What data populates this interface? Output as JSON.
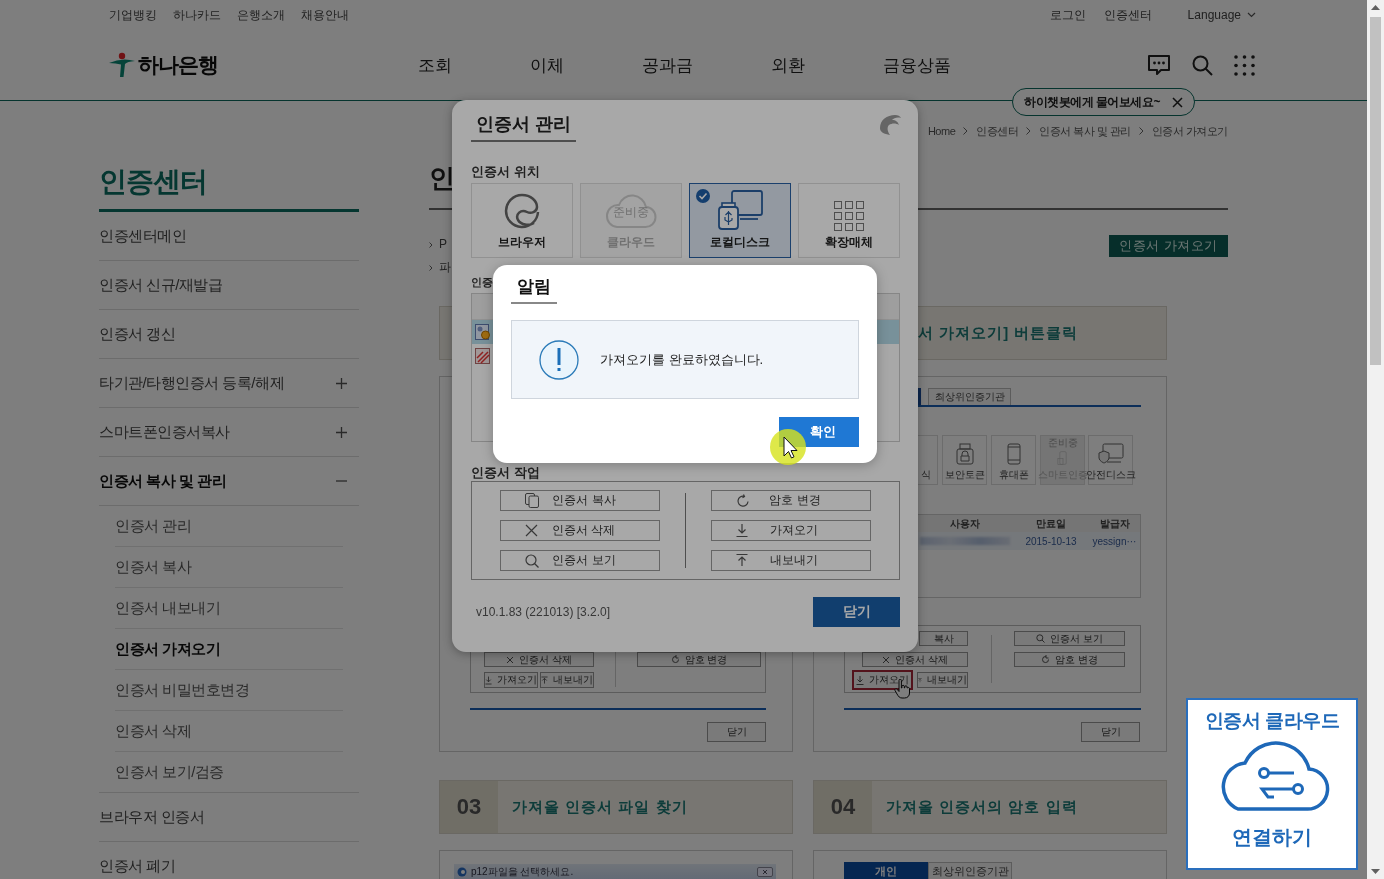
{
  "header": {
    "top_links": [
      "기업뱅킹",
      "하나카드",
      "은행소개",
      "채용안내"
    ],
    "login": "로그인",
    "cert_center": "인증센터",
    "language": "Language",
    "logo": "하나은행",
    "nav": [
      "조회",
      "이체",
      "공과금",
      "외환",
      "금융상품"
    ],
    "chatbot_tip": "하이챗봇에게 물어보세요~"
  },
  "sidebar": {
    "title": "인증센터",
    "items": [
      {
        "label": "인증센터메인",
        "kind": "link"
      },
      {
        "label": "인증서 신규/재발급",
        "kind": "link"
      },
      {
        "label": "인증서 갱신",
        "kind": "link"
      },
      {
        "label": "타기관/타행인증서 등록/해제",
        "kind": "group",
        "expanded": false
      },
      {
        "label": "스마트폰인증서복사",
        "kind": "group",
        "expanded": false
      },
      {
        "label": "인증서 복사 및 관리",
        "kind": "group",
        "expanded": true,
        "children": [
          {
            "label": "인증서 관리",
            "selected": false
          },
          {
            "label": "인증서 복사",
            "selected": false
          },
          {
            "label": "인증서 내보내기",
            "selected": false
          },
          {
            "label": "인증서 가져오기",
            "selected": true
          },
          {
            "label": "인증서 비밀번호변경",
            "selected": false
          },
          {
            "label": "인증서 삭제",
            "selected": false
          },
          {
            "label": "인증서 보기/검증",
            "selected": false
          }
        ]
      },
      {
        "label": "브라우저 인증서",
        "kind": "link"
      },
      {
        "label": "인증서 폐기",
        "kind": "link"
      }
    ]
  },
  "main": {
    "breadcrumb": [
      "Home",
      "인증센터",
      "인증서 복사 및 관리",
      "인증서 가져오기"
    ],
    "title": "인",
    "bullets": [
      "P",
      "파"
    ],
    "import_button": "인증서 가져오기",
    "steps": [
      {
        "kind": "tail",
        "left_buttons": [
          "인증서 삭제"
        ],
        "small_buttons": [
          {
            "label": "가져오기",
            "highlighted": false
          },
          {
            "label": "내보내기",
            "highlighted": false
          }
        ],
        "right_buttons": [
          "암호 변경"
        ],
        "close": "닫기"
      },
      {
        "title": "서 가져오기] 버튼클릭",
        "kind": "manager",
        "tab": "최상위인증기관",
        "media": [
          {
            "label": "식",
            "disabled": false
          },
          {
            "label": "보안토큰",
            "disabled": false
          },
          {
            "label": "휴대폰",
            "disabled": false
          },
          {
            "label": "스마트인증",
            "disabled": true,
            "note": "준비중"
          },
          {
            "label": "안전디스크",
            "disabled": false
          }
        ],
        "columns": [
          "사용자",
          "만료일",
          "발급자"
        ],
        "row": [
          "2015-10-13",
          "yessign···"
        ],
        "left_buttons": [
          "복사",
          "인증서 삭제"
        ],
        "small_buttons": [
          {
            "label": "가져오기",
            "highlighted": true
          },
          {
            "label": "내보내기",
            "highlighted": false
          }
        ],
        "right_buttons": [
          "인증서 보기",
          "암호 변경"
        ],
        "close": "닫기"
      },
      {
        "number": "03",
        "title": "가져올 인증서 파일 찾기",
        "kind": "file",
        "window_title": "p12파일을 선택하세요."
      },
      {
        "number": "04",
        "title": "가져올 인증서의 암호 입력",
        "kind": "tabs",
        "tabs": [
          {
            "label": "개인",
            "selected": true
          },
          {
            "label": "최상위인증기관",
            "selected": false
          }
        ]
      }
    ]
  },
  "cert_dialog": {
    "title": "인증서 관리",
    "location_label": "인증서 위치",
    "locations": [
      {
        "label": "브라우저",
        "selected": false,
        "disabled": false
      },
      {
        "label": "클라우드",
        "selected": false,
        "disabled": true,
        "note": "준비중"
      },
      {
        "label": "로컬디스크",
        "selected": true,
        "disabled": false
      },
      {
        "label": "확장매체",
        "selected": false,
        "disabled": false
      }
    ],
    "list_label": "인증",
    "certs": [
      {
        "kind": "valid",
        "selected": true
      },
      {
        "kind": "expired",
        "selected": false
      }
    ],
    "tasks_label": "인증서 작업",
    "tasks_left": [
      "인증서 복사",
      "인증서 삭제",
      "인증서 보기"
    ],
    "tasks_right": [
      "암호 변경",
      "가져오기",
      "내보내기"
    ],
    "version": "v10.1.83 (221013) [3.2.0]",
    "close": "닫기"
  },
  "alert": {
    "title": "알림",
    "message": "가져오기를 완료하였습니다.",
    "ok": "확인"
  },
  "cloud": {
    "title": "인증서 클라우드",
    "action": "연결하기"
  }
}
